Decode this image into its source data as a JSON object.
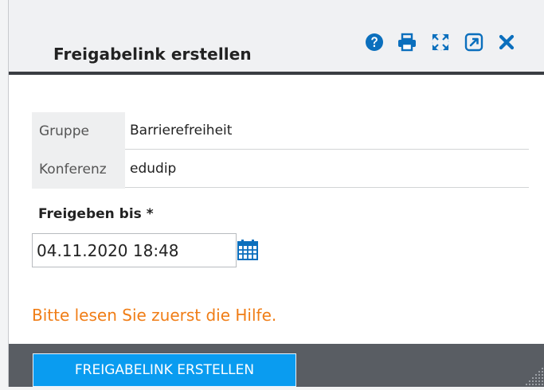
{
  "dialog": {
    "title": "Freigabelink erstellen",
    "toolbar": {
      "help_icon": "help-circle-icon",
      "print_icon": "printer-icon",
      "fullscreen_icon": "expand-icon",
      "external_icon": "open-external-icon",
      "close_icon": "close-icon",
      "icon_color": "#0b6fbd"
    }
  },
  "info": {
    "rows": [
      {
        "label": "Gruppe",
        "value": "Barrierefreiheit"
      },
      {
        "label": "Konferenz",
        "value": "edudip"
      }
    ]
  },
  "share_until": {
    "label": "Freigeben bis *",
    "value": "04.11.2020 18:48",
    "calendar_icon": "calendar-icon"
  },
  "help_message": "Bitte lesen Sie zuerst die Hilfe.",
  "footer": {
    "submit_label": "FREIGABELINK ERSTELLEN"
  },
  "colors": {
    "accent": "#0a9cf0",
    "warning_text": "#f07d16",
    "footer_bg": "#595d63",
    "header_border": "#3a3d42"
  }
}
